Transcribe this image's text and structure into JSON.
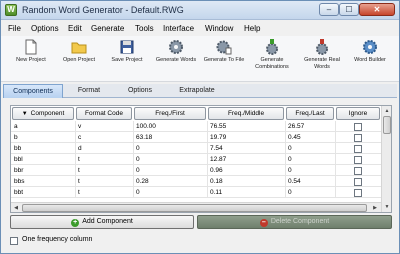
{
  "window": {
    "title": "Random Word Generator - Default.RWG",
    "app_icon_glyph": "W"
  },
  "window_buttons": {
    "minimize": "–",
    "maximize": "☐",
    "close": "✕"
  },
  "menu": [
    "File",
    "Options",
    "Edit",
    "Generate",
    "Tools",
    "Interface",
    "Window",
    "Help"
  ],
  "toolbar": [
    {
      "label": "New Project",
      "icon": "new-document-icon"
    },
    {
      "label": "Open Project",
      "icon": "open-folder-icon"
    },
    {
      "label": "Save Project",
      "icon": "floppy-disk-icon"
    },
    {
      "label": "Generate Words",
      "icon": "gear-icon"
    },
    {
      "label": "Generate To File",
      "icon": "gear-file-icon"
    },
    {
      "label": "Generate Combinations",
      "icon": "abc-gear-icon"
    },
    {
      "label": "Generate Real Words",
      "icon": "cat-gear-icon"
    },
    {
      "label": "Word Builder",
      "icon": "gear-icon"
    }
  ],
  "tabs": [
    "Components",
    "Format",
    "Options",
    "Extrapolate"
  ],
  "active_tab": "Components",
  "grid": {
    "headers": [
      "Component",
      "Format Code",
      "Freq./First",
      "Freq./Middle",
      "Freq./Last",
      "Ignore"
    ],
    "sort_indicator": "▼",
    "rows": [
      {
        "component": "a",
        "format": "v",
        "first": "100.00",
        "middle": "76.55",
        "last": "26.57",
        "ignore": false
      },
      {
        "component": "b",
        "format": "c",
        "first": "63.18",
        "middle": "19.79",
        "last": "0.45",
        "ignore": false
      },
      {
        "component": "bb",
        "format": "d",
        "first": "0",
        "middle": "7.54",
        "last": "0",
        "ignore": false
      },
      {
        "component": "bbl",
        "format": "t",
        "first": "0",
        "middle": "12.87",
        "last": "0",
        "ignore": false
      },
      {
        "component": "bbr",
        "format": "t",
        "first": "0",
        "middle": "0.96",
        "last": "0",
        "ignore": false
      },
      {
        "component": "bbs",
        "format": "t",
        "first": "0.28",
        "middle": "0.18",
        "last": "0.54",
        "ignore": false
      },
      {
        "component": "bbt",
        "format": "t",
        "first": "0",
        "middle": "0.11",
        "last": "0",
        "ignore": false
      }
    ]
  },
  "buttons": {
    "add": "Add Component",
    "delete": "Delete Component"
  },
  "options": {
    "one_frequency_label": "One frequency column",
    "one_frequency_checked": false
  },
  "colors": {
    "active_tab": "#b7d1f0",
    "add_icon": "#3a9b2a",
    "delete_icon": "#c0392b",
    "delete_button": "#7f8f7c"
  }
}
